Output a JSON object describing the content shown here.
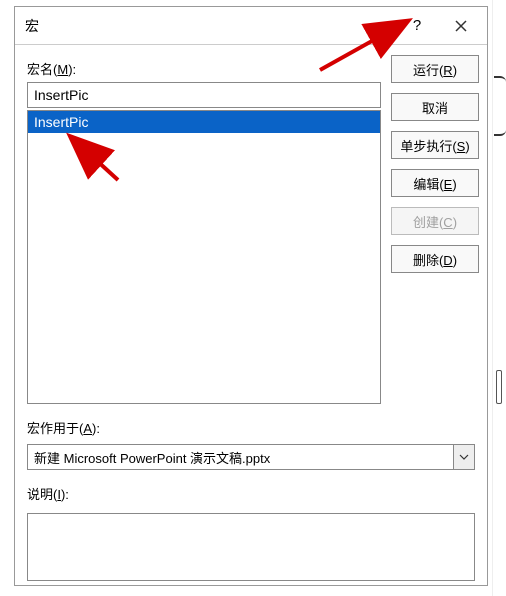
{
  "titlebar": {
    "title": "宏",
    "help": "?",
    "close_icon": "close-icon"
  },
  "labels": {
    "macro_name": "宏名(",
    "macro_name_key": "M",
    "macro_name_end": "):",
    "applies": "宏作用于(",
    "applies_key": "A",
    "applies_end": "):",
    "desc": "说明(",
    "desc_key": "I",
    "desc_end": "):"
  },
  "input": {
    "macro_name_value": "InsertPic"
  },
  "list": {
    "items": [
      "InsertPic"
    ],
    "selected_index": 0
  },
  "buttons": {
    "run": "运行(",
    "run_key": "R",
    "run_end": ")",
    "cancel": "取消",
    "step": "单步执行(",
    "step_key": "S",
    "step_end": ")",
    "edit": "编辑(",
    "edit_key": "E",
    "edit_end": ")",
    "create": "创建(",
    "create_key": "C",
    "create_end": ")",
    "delete": "删除(",
    "delete_key": "D",
    "delete_end": ")"
  },
  "applies_select": {
    "value": "新建 Microsoft PowerPoint 演示文稿.pptx"
  },
  "description": {
    "value": ""
  }
}
